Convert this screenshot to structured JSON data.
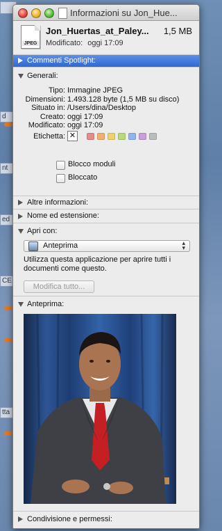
{
  "window": {
    "title": "Informazioni su Jon_Hue..."
  },
  "file": {
    "icon_label": "JPEG",
    "name": "Jon_Huertas_at_Paley...",
    "size": "1,5 MB",
    "modified_label": "Modificato:",
    "modified_value": "oggi 17:09"
  },
  "sections": {
    "spotlight": "Commenti Spotlight:",
    "general": "Generali:",
    "more_info": "Altre informazioni:",
    "name_ext": "Nome ed estensione:",
    "open_with": "Apri con:",
    "preview": "Anteprima:",
    "sharing": "Condivisione e permessi:"
  },
  "general": {
    "rows": [
      {
        "k": "Tipo:",
        "v": "Immagine JPEG"
      },
      {
        "k": "Dimensioni:",
        "v": "1.493.128 byte (1,5 MB su disco)"
      },
      {
        "k": "Situato in:",
        "v": "/Users/dina/Desktop"
      },
      {
        "k": "Creato:",
        "v": "oggi 17:09"
      },
      {
        "k": "Modificato:",
        "v": "oggi 17:09"
      }
    ],
    "label_key": "Etichetta:",
    "label_clear": "✕",
    "label_colors": [
      "#e88a8a",
      "#f0b070",
      "#eed36a",
      "#b9d97a",
      "#8fb5ee",
      "#c8a0dc",
      "#bdbdbd"
    ],
    "stationery": "Blocco moduli",
    "locked": "Bloccato"
  },
  "open_with": {
    "app": "Anteprima",
    "description": "Utilizza questa applicazione per aprire tutti i documenti come questo.",
    "change_all": "Modifica tutto..."
  },
  "desktop": {
    "items": [
      "d",
      "nt",
      "ed",
      "CE",
      "tta"
    ]
  },
  "colors": {
    "selected_header": "#2f68d1",
    "suit": "#3d3f44",
    "tie": "#c02020"
  }
}
